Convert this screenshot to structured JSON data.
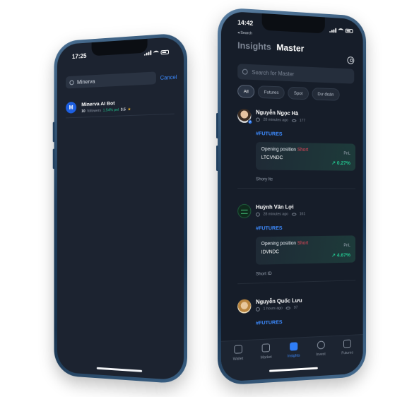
{
  "left_phone": {
    "status": {
      "time": "17:25"
    },
    "search": {
      "query": "Minerva",
      "cancel_label": "Cancel"
    },
    "result": {
      "avatar_letter": "M",
      "name": "Minerva AI Bot",
      "followers_count": "10",
      "followers_label": "followers",
      "pnl": "1.54% pnl",
      "rating": "3.5",
      "rating_icon": "star-icon"
    }
  },
  "right_phone": {
    "status": {
      "time": "14:42"
    },
    "back_label": "◂ Search",
    "header": {
      "tab_insights": "Insights",
      "tab_master": "Master"
    },
    "search": {
      "placeholder": "Search for Master"
    },
    "chips": [
      "All",
      "Futures",
      "Spot",
      "Dư đoán"
    ],
    "posts": [
      {
        "author": "Nguyễn Ngọc Hà",
        "time": "28 minutes ago",
        "views": "177",
        "tag": "#FUTURES",
        "position_label": "Opening position",
        "position_side": "Short",
        "symbol": "LTCVNDC",
        "pnl_label": "PnL",
        "pnl_value": "↗ 0.27%",
        "caption": "Shory ltc"
      },
      {
        "author": "Huỳnh Văn Lợi",
        "time": "28 minutes ago",
        "views": "161",
        "tag": "#FUTURES",
        "position_label": "Opening position",
        "position_side": "Short",
        "symbol": "IDVNDC",
        "pnl_label": "PnL",
        "pnl_value": "↗ 4.67%",
        "caption": "Short ID"
      },
      {
        "author": "Nguyễn Quốc Lưu",
        "time": "1 hours ago",
        "views": "97",
        "tag": "#FUTURES"
      }
    ],
    "nav": [
      {
        "label": "Wallet",
        "icon": "wallet-icon"
      },
      {
        "label": "Market",
        "icon": "chart-icon"
      },
      {
        "label": "Insights",
        "icon": "insights-icon",
        "active": true
      },
      {
        "label": "Invest",
        "icon": "invest-icon"
      },
      {
        "label": "Futures",
        "icon": "futures-icon"
      }
    ],
    "colors": {
      "accent": "#2f7df6",
      "positive": "#22c38e",
      "short": "#e5485a"
    }
  }
}
